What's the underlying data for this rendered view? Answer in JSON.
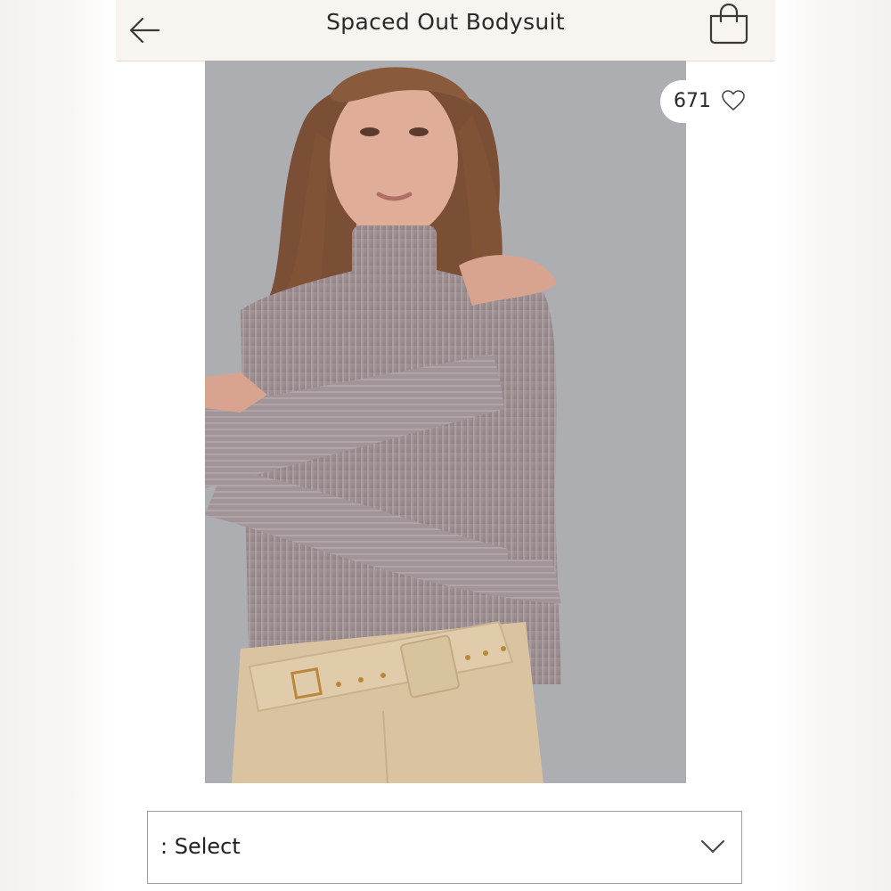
{
  "header": {
    "title": "Spaced Out Bodysuit",
    "back_icon": "arrow-left-icon",
    "bag_icon": "shopping-bag-icon"
  },
  "product_image": {
    "icon": "model-photo",
    "like_count": "671",
    "like_icon": "heart-outline-icon"
  },
  "selector": {
    "label": ": Select",
    "icon": "chevron-down-icon"
  },
  "colors": {
    "header_bg": "#f8f4ef",
    "photo_bg": "#acadb1",
    "text": "#2a2a2a"
  }
}
